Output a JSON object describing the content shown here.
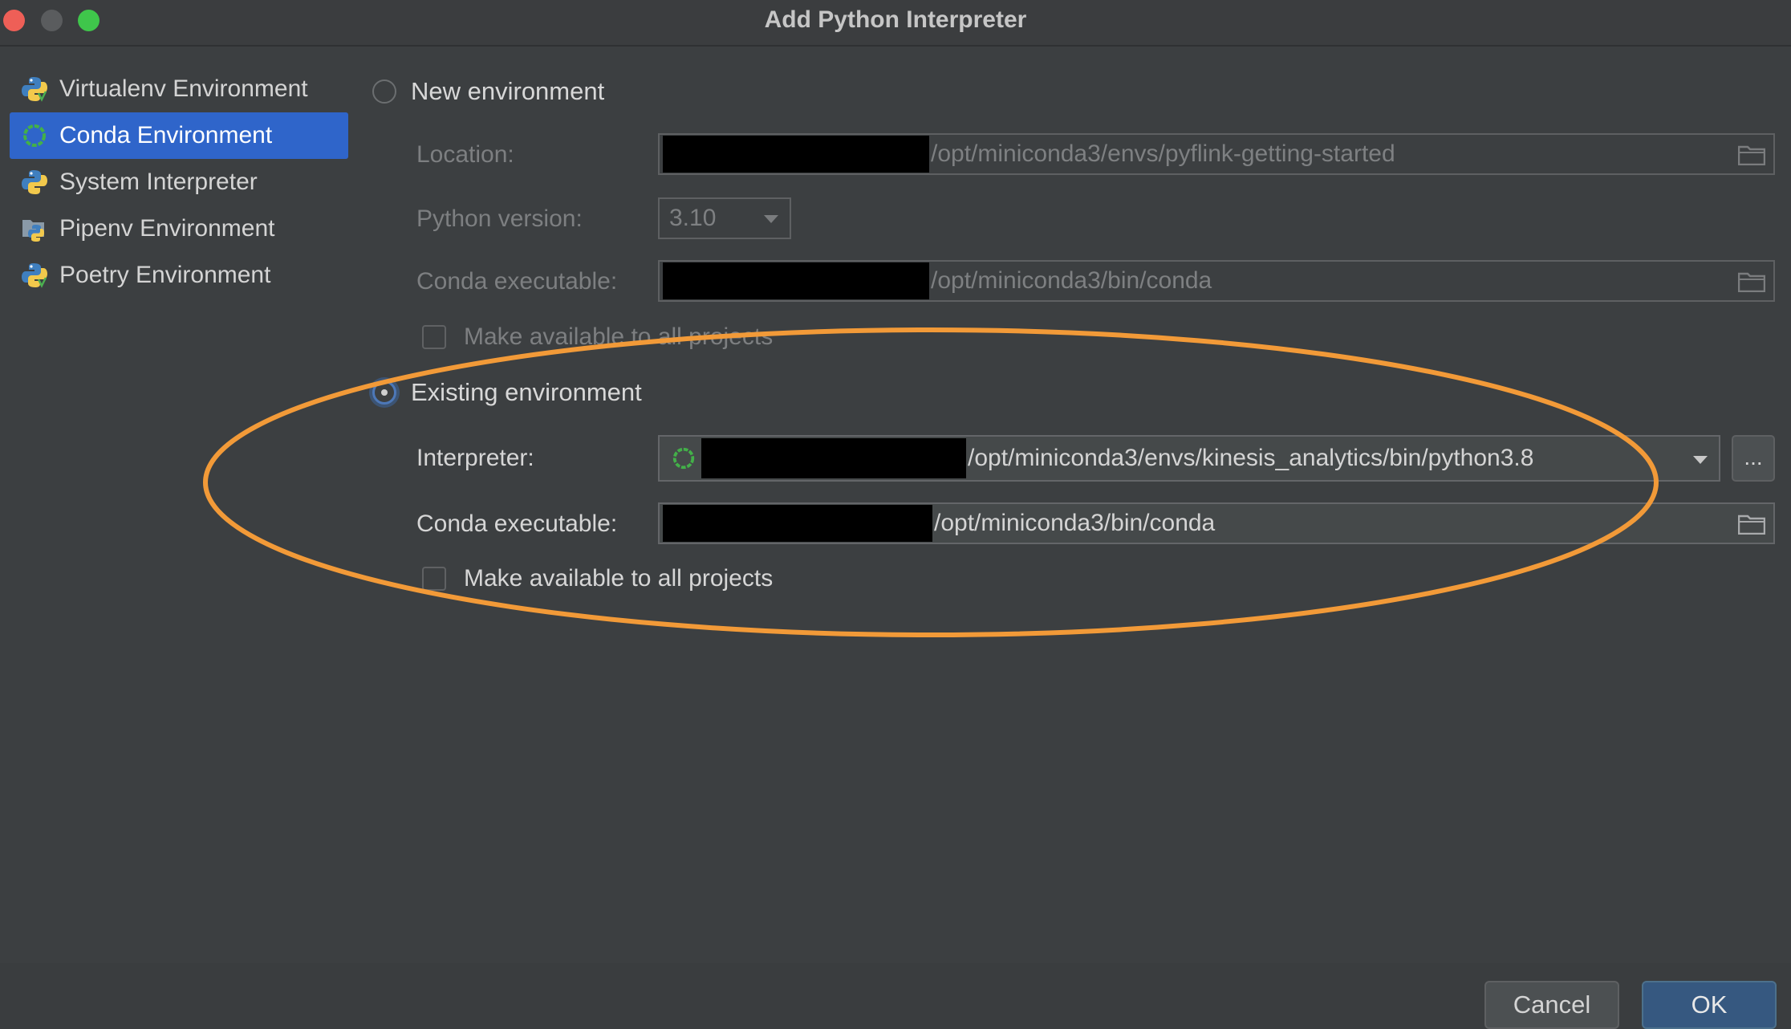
{
  "window": {
    "title": "Add Python Interpreter"
  },
  "sidebar": {
    "items": [
      {
        "label": "Virtualenv Environment",
        "icon": "python-icon",
        "selected": false
      },
      {
        "label": "Conda Environment",
        "icon": "conda-icon",
        "selected": true
      },
      {
        "label": "System Interpreter",
        "icon": "python-icon",
        "selected": false
      },
      {
        "label": "Pipenv Environment",
        "icon": "pipenv-icon",
        "selected": false
      },
      {
        "label": "Poetry Environment",
        "icon": "poetry-icon",
        "selected": false
      }
    ]
  },
  "new_env": {
    "radio_label": "New environment",
    "location_label": "Location:",
    "location_value": "/opt/miniconda3/envs/pyflink-getting-started",
    "python_version_label": "Python version:",
    "python_version_value": "3.10",
    "conda_exec_label": "Conda executable:",
    "conda_exec_value": "/opt/miniconda3/bin/conda",
    "make_available_label": "Make available to all projects"
  },
  "existing_env": {
    "radio_label": "Existing environment",
    "interpreter_label": "Interpreter:",
    "interpreter_value": "/opt/miniconda3/envs/kinesis_analytics/bin/python3.8",
    "more_label": "...",
    "conda_exec_label": "Conda executable:",
    "conda_exec_value": "/opt/miniconda3/bin/conda",
    "make_available_label": "Make available to all projects"
  },
  "buttons": {
    "cancel": "Cancel",
    "ok": "OK"
  },
  "colors": {
    "accent": "#2f65ca",
    "highlight": "#f29a38",
    "background": "#3c3f41"
  }
}
